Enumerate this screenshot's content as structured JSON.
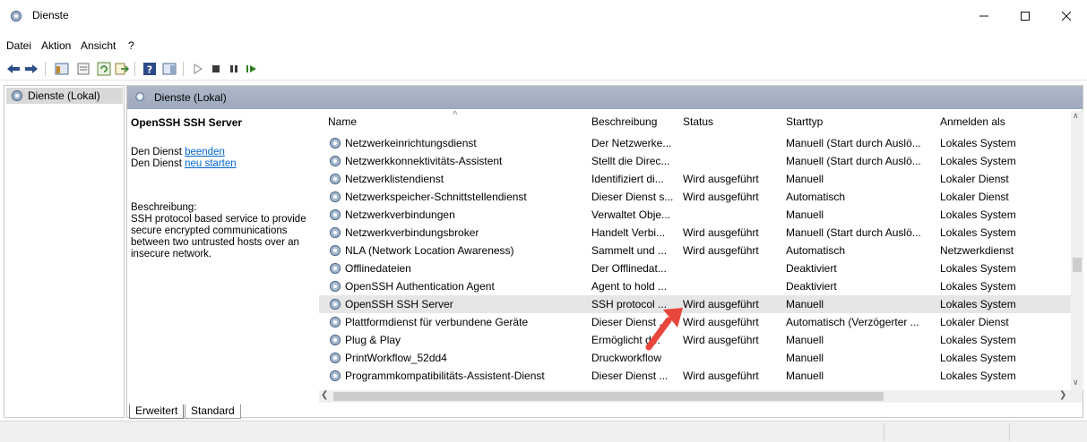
{
  "window": {
    "title": "Dienste"
  },
  "menu": [
    "Datei",
    "Aktion",
    "Ansicht",
    "?"
  ],
  "tree": {
    "item": "Dienste (Lokal)"
  },
  "main": {
    "header": "Dienste (Lokal)",
    "selected_service": "OpenSSH SSH Server",
    "action_prefix_1": "Den Dienst ",
    "action_link_1": "beenden",
    "action_prefix_2": "Den Dienst ",
    "action_link_2": "neu starten",
    "description_label": "Beschreibung:",
    "description_lines": [
      "SSH protocol based service to provide",
      "secure encrypted communications",
      "between two untrusted hosts over an",
      "insecure network."
    ]
  },
  "table": {
    "columns": [
      "Name",
      "Beschreibung",
      "Status",
      "Starttyp",
      "Anmelden als"
    ],
    "rows": [
      {
        "name": "Netzwerkeinrichtungsdienst",
        "desc": "Der Netzwerke...",
        "status": "",
        "start": "Manuell (Start durch Auslö...",
        "login": "Lokales System"
      },
      {
        "name": "Netzwerkkonnektivitäts-Assistent",
        "desc": "Stellt die Direc...",
        "status": "",
        "start": "Manuell (Start durch Auslö...",
        "login": "Lokales System"
      },
      {
        "name": "Netzwerklistendienst",
        "desc": "Identifiziert di...",
        "status": "Wird ausgeführt",
        "start": "Manuell",
        "login": "Lokaler Dienst"
      },
      {
        "name": "Netzwerkspeicher-Schnittstellendienst",
        "desc": "Dieser Dienst s...",
        "status": "Wird ausgeführt",
        "start": "Automatisch",
        "login": "Lokaler Dienst"
      },
      {
        "name": "Netzwerkverbindungen",
        "desc": "Verwaltet Obje...",
        "status": "",
        "start": "Manuell",
        "login": "Lokales System"
      },
      {
        "name": "Netzwerkverbindungsbroker",
        "desc": "Handelt Verbi...",
        "status": "Wird ausgeführt",
        "start": "Manuell (Start durch Auslö...",
        "login": "Lokales System"
      },
      {
        "name": "NLA (Network Location Awareness)",
        "desc": "Sammelt und ...",
        "status": "Wird ausgeführt",
        "start": "Automatisch",
        "login": "Netzwerkdienst"
      },
      {
        "name": "Offlinedateien",
        "desc": "Der Offlinedat...",
        "status": "",
        "start": "Deaktiviert",
        "login": "Lokales System"
      },
      {
        "name": "OpenSSH Authentication Agent",
        "desc": "Agent to hold ...",
        "status": "",
        "start": "Deaktiviert",
        "login": "Lokales System"
      },
      {
        "name": "OpenSSH SSH Server",
        "desc": "SSH protocol ...",
        "status": "Wird ausgeführt",
        "start": "Manuell",
        "login": "Lokales System"
      },
      {
        "name": "Plattformdienst für verbundene Geräte",
        "desc": "Dieser Dienst ...",
        "status": "Wird ausgeführt",
        "start": "Automatisch (Verzögerter ...",
        "login": "Lokaler Dienst"
      },
      {
        "name": "Plug & Play",
        "desc": "Ermöglicht d...",
        "status": "Wird ausgeführt",
        "start": "Manuell",
        "login": "Lokales System"
      },
      {
        "name": "PrintWorkflow_52dd4",
        "desc": "Druckworkflow",
        "status": "",
        "start": "Manuell",
        "login": "Lokales System"
      },
      {
        "name": "Programmkompatibilitäts-Assistent-Dienst",
        "desc": "Dieser Dienst ...",
        "status": "Wird ausgeführt",
        "start": "Manuell",
        "login": "Lokales System"
      }
    ]
  },
  "tabs": [
    "Erweitert",
    "Standard"
  ],
  "colors": {
    "header_bg": "#a6b2c4",
    "link": "#0066cc",
    "arrow": "#e8463c",
    "selected_row": "#e6e6e6"
  }
}
